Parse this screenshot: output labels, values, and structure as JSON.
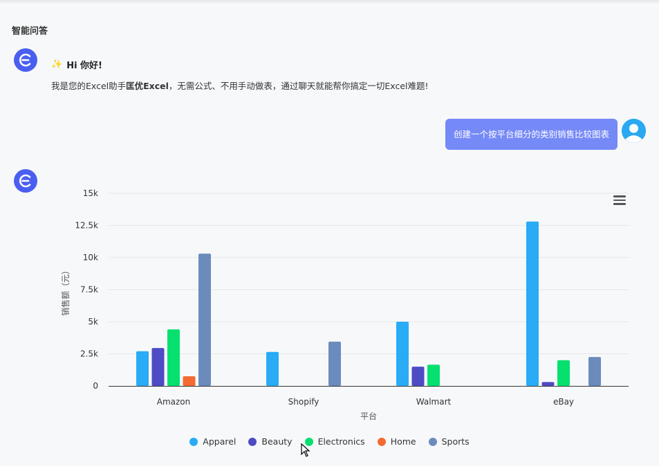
{
  "section": {
    "title": "智能问答"
  },
  "bot": {
    "greeting_emoji": "✨",
    "greeting": "Hi 你好!",
    "intro_prefix": "我是您的Excel助手",
    "intro_brand": "匡优Excel",
    "intro_suffix": "，无需公式、不用手动做表，通过聊天就能帮你搞定一切Excel难题!"
  },
  "user": {
    "message": "创建一个按平台细分的类别销售比较图表"
  },
  "colors": {
    "bot_avatar": "#4a5ff0",
    "user_bubble": "#7589f7",
    "user_avatar": "#2aa8f2"
  },
  "chart_data": {
    "type": "bar",
    "categories": [
      "Amazon",
      "Shopify",
      "Walmart",
      "eBay"
    ],
    "series": [
      {
        "name": "Apparel",
        "color": "#29abf6",
        "values": [
          2700,
          2650,
          5000,
          12800
        ]
      },
      {
        "name": "Beauty",
        "color": "#4e4bc4",
        "values": [
          2950,
          0,
          1500,
          300
        ]
      },
      {
        "name": "Electronics",
        "color": "#05e06e",
        "values": [
          4400,
          0,
          1650,
          2000
        ]
      },
      {
        "name": "Home",
        "color": "#f36b32",
        "values": [
          750,
          0,
          0,
          0
        ]
      },
      {
        "name": "Sports",
        "color": "#6b8bbd",
        "values": [
          10300,
          3450,
          0,
          2250
        ]
      }
    ],
    "y_ticks": [
      "0",
      "2.5k",
      "5k",
      "7.5k",
      "10k",
      "12.5k",
      "15k"
    ],
    "ylim": [
      0,
      15000
    ],
    "xlabel": "平台",
    "ylabel": "销售额（元）",
    "grid": true,
    "legend_position": "bottom"
  }
}
